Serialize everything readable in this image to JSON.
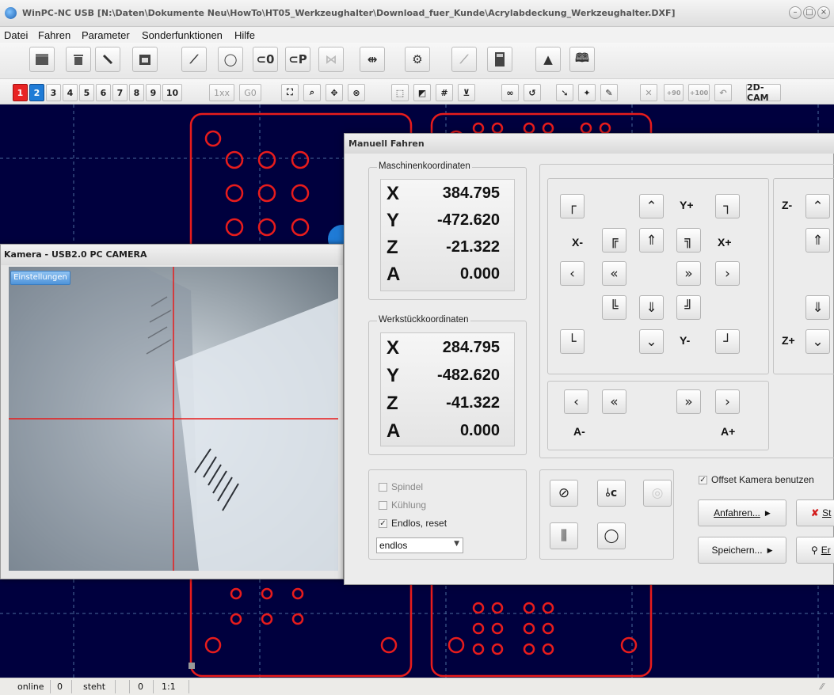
{
  "window": {
    "title": "WinPC-NC USB [N:\\Daten\\Dokumente Neu\\HowTo\\HT05_Werkzeughalter\\Download_fuer_Kunde\\Acrylabdeckung_Werkzeughalter.DXF]",
    "controls": [
      "minimize",
      "maximize",
      "close"
    ]
  },
  "menu": [
    "Datei",
    "Fahren",
    "Parameter",
    "Sonderfunktionen",
    "Hilfe"
  ],
  "toolbar1": {
    "text_buttons": {
      "zero": "⊂0",
      "park": "⊂P"
    },
    "icons": [
      "clapperboard-icon",
      "bin-icon",
      "pencil-icon",
      "calendar-icon",
      "line-icon",
      "circle-arrows-icon",
      "zero-point-icon",
      "park-position-icon",
      "toolchange-icon",
      "align-icon",
      "gears-icon",
      "wrench-icon",
      "calculator-icon",
      "warning-icon",
      "book-icon"
    ]
  },
  "toolbar2": {
    "tool_numbers": [
      "1",
      "2",
      "3",
      "4",
      "5",
      "6",
      "7",
      "8",
      "9",
      "10"
    ],
    "active_red": "1",
    "active_blue": "2",
    "mode_1xx": "1xx",
    "mode_g0": "G0",
    "extra_labels": {
      "plus90": "+90",
      "plus100": "+100"
    },
    "cam_button": "2D-CAM"
  },
  "camera": {
    "title": "Kamera - USB2.0 PC CAMERA",
    "settings_button": "Einstellungen"
  },
  "manual": {
    "title": "Manuell Fahren",
    "machine": {
      "label": "Maschinenkoordinaten",
      "rows": [
        {
          "axis": "X",
          "value": "384.795"
        },
        {
          "axis": "Y",
          "value": "-472.620"
        },
        {
          "axis": "Z",
          "value": "-21.322"
        },
        {
          "axis": "A",
          "value": "0.000"
        }
      ]
    },
    "workpiece": {
      "label": "Werkstückkoordinaten",
      "rows": [
        {
          "axis": "X",
          "value": "284.795"
        },
        {
          "axis": "Y",
          "value": "-482.620"
        },
        {
          "axis": "Z",
          "value": "-41.322"
        },
        {
          "axis": "A",
          "value": "0.000"
        }
      ]
    },
    "jog_labels": {
      "y_plus": "Y+",
      "y_minus": "Y-",
      "x_minus": "X-",
      "x_plus": "X+",
      "z_minus": "Z-",
      "z_plus": "Z+",
      "a_minus": "A-",
      "a_plus": "A+"
    },
    "options": {
      "spindle": "Spindel",
      "cooling": "Kühlung",
      "endless": "Endlos, reset",
      "endless_checked": true,
      "mode_select": "endlos",
      "offset_camera": "Offset Kamera benutzen",
      "offset_checked": true
    },
    "buttons": {
      "approach": "Anfahren...",
      "save": "Speichern...",
      "stop_partial": "St",
      "end_partial": "Er"
    }
  },
  "status": {
    "state": "online",
    "v1": "0",
    "motion": "steht",
    "v2": "0",
    "scale": "1:1"
  },
  "colors": {
    "canvas": "#00003e",
    "contour": "#e81c1c",
    "grid": "#4a6a9a",
    "accent_blue": "#1f7bd6"
  }
}
